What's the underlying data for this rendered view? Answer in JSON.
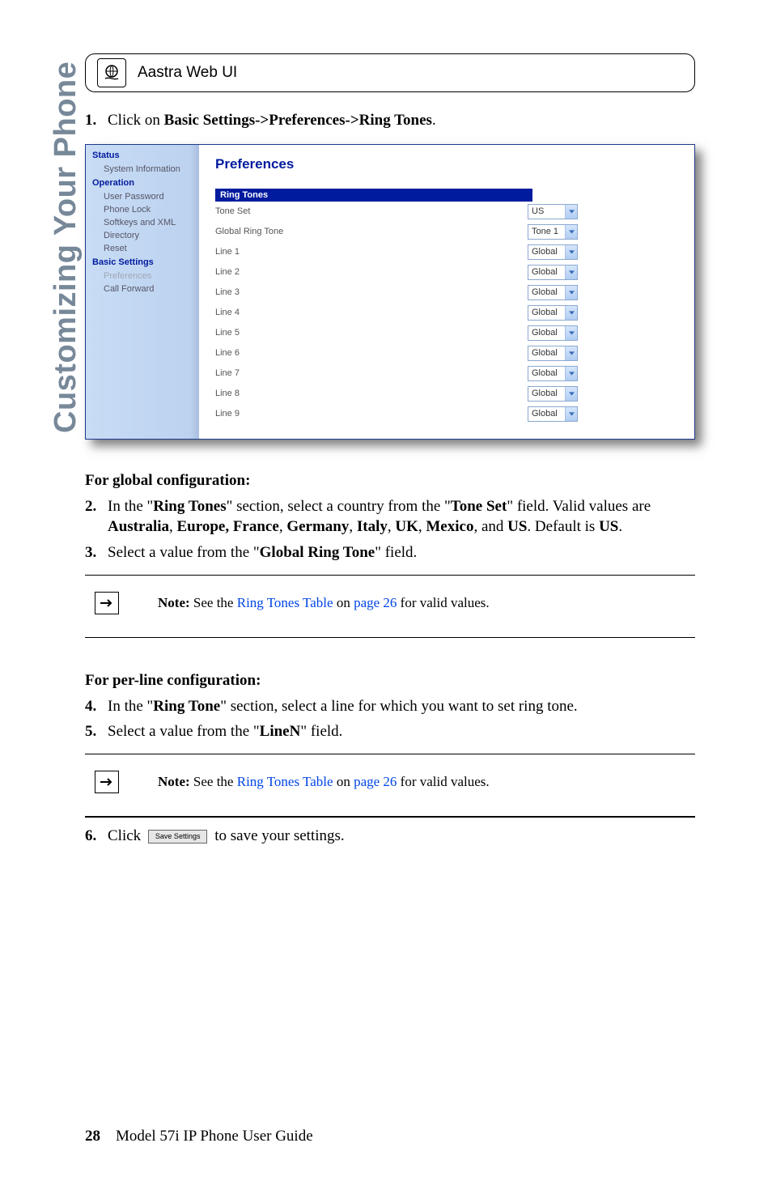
{
  "side_title": "Customizing Your Phone",
  "web_ui_label": "Aastra Web UI",
  "step1_prefix": "Click on ",
  "step1_bold": "Basic Settings->Preferences->Ring Tones",
  "nav": {
    "status": "Status",
    "system_info": "System Information",
    "operation": "Operation",
    "user_password": "User Password",
    "phone_lock": "Phone Lock",
    "softkeys_xml": "Softkeys and XML",
    "directory": "Directory",
    "reset": "Reset",
    "basic_settings": "Basic Settings",
    "preferences": "Preferences",
    "call_forward": "Call Forward"
  },
  "prefs": {
    "title": "Preferences",
    "section": "Ring Tones",
    "tone_set_label": "Tone Set",
    "tone_set_value": "US",
    "global_label": "Global Ring Tone",
    "global_value": "Tone 1",
    "lines": [
      {
        "label": "Line 1",
        "value": "Global"
      },
      {
        "label": "Line 2",
        "value": "Global"
      },
      {
        "label": "Line 3",
        "value": "Global"
      },
      {
        "label": "Line 4",
        "value": "Global"
      },
      {
        "label": "Line 5",
        "value": "Global"
      },
      {
        "label": "Line 6",
        "value": "Global"
      },
      {
        "label": "Line 7",
        "value": "Global"
      },
      {
        "label": "Line 8",
        "value": "Global"
      },
      {
        "label": "Line 9",
        "value": "Global"
      }
    ]
  },
  "global_hdr": "For global configuration:",
  "step2_a": "In the \"",
  "step2_b": "Ring Tones",
  "step2_c": "\" section, select a country from the \"",
  "step2_d": "Tone Set",
  "step2_e": "\" field. Valid values are ",
  "countries": {
    "au": "Australia",
    "eu": "Europe, France",
    "de": "Germany",
    "it": "Italy",
    "uk": "UK",
    "mx": "Mexico",
    "us": "US"
  },
  "step2_default_a": ". Default is ",
  "step3_a": "Select a value from the \"",
  "step3_b": "Global Ring Tone",
  "step3_c": "\" field",
  "note_prefix": "Note:",
  "note_body_a": " See the ",
  "note_link1": "Ring Tones Table",
  "note_body_b": " on ",
  "note_link2": "page 26",
  "note_body_c": " for valid values.",
  "perline_hdr": "For per-line configuration:",
  "step4_a": "In the \"",
  "step4_b": "Ring Tone",
  "step4_c": "\" section, select a line for which you want to set ring tone.",
  "step5_a": "Select a value from the \"",
  "step5_b": "LineN",
  "step5_c": "\" field",
  "step6_a": "Click ",
  "step6_btn": "Save Settings",
  "step6_b": " to save your settings.",
  "footer_page": "28",
  "footer_text": "Model 57i IP Phone User Guide"
}
